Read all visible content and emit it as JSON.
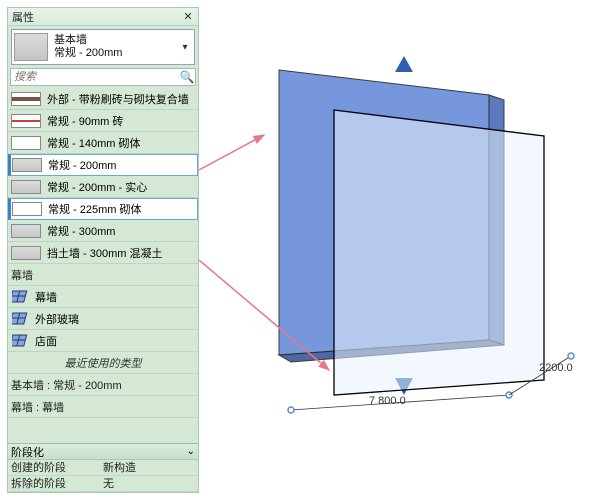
{
  "panel": {
    "title": "属性",
    "selector": {
      "line1": "基本墙",
      "line2": "常规 - 200mm"
    },
    "searchPlaceholder": "搜索"
  },
  "rows": {
    "r0": "外部 - 带粉刷砖与砌块复合墙",
    "r1": "常规 - 90mm 砖",
    "r2": "常规 - 140mm 砌体",
    "r3": "常规 - 200mm",
    "r4": "常规 - 200mm - 实心",
    "r5": "常规 - 225mm 砌体",
    "r6": "常规 - 300mm",
    "r7": "挡土墙 - 300mm 混凝土",
    "sectCurtain": "幕墙",
    "c0": "幕墙",
    "c1": "外部玻璃",
    "c2": "店面",
    "recent": "最近使用的类型",
    "recent0": "基本墙 : 常规 - 200mm",
    "recent1": "幕墙 : 幕墙"
  },
  "bottom": {
    "title": "阶段化",
    "k0": "创建的阶段",
    "v0": "新构造",
    "k1": "拆除的阶段",
    "v1": "无"
  },
  "dims": {
    "width": "7 800.0",
    "depth": "2200.0"
  }
}
